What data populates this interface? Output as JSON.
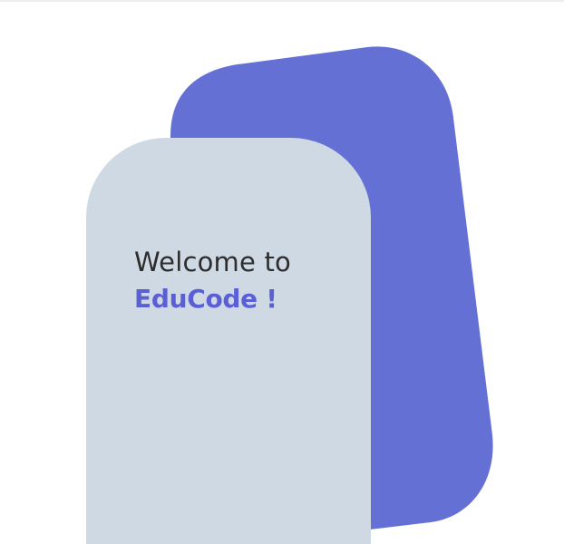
{
  "hero": {
    "welcome_text": "Welcome to",
    "brand_text": "EduCode !"
  },
  "colors": {
    "background": "#ffffff",
    "blob": "#6570d4",
    "card": "#cfd9e4",
    "welcome_text": "#2d2d2d",
    "brand_text": "#5b5fd6"
  }
}
